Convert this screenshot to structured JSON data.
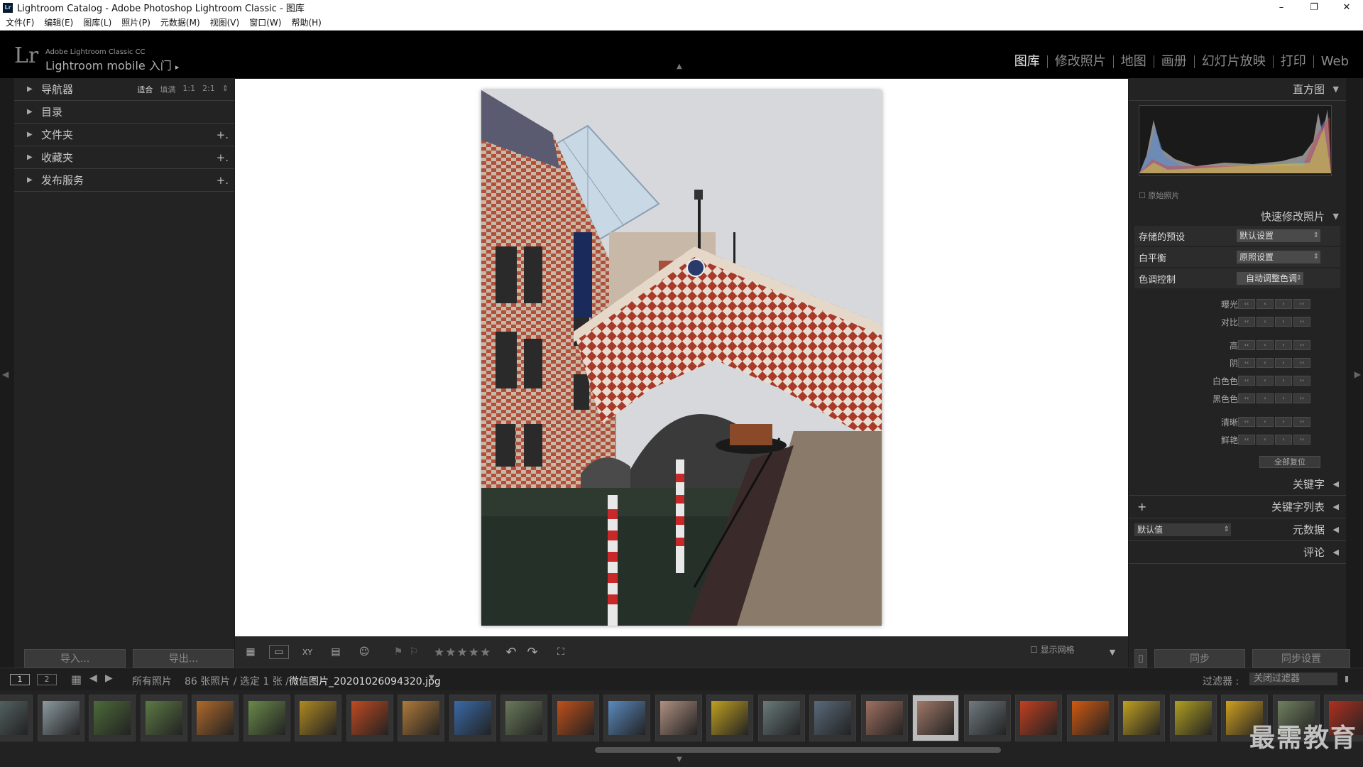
{
  "window": {
    "title": "Lightroom Catalog - Adobe Photoshop Lightroom Classic - 图库",
    "minimize": "–",
    "maximize": "❐",
    "close": "✕"
  },
  "menu": [
    "文件(F)",
    "编辑(E)",
    "图库(L)",
    "照片(P)",
    "元数据(M)",
    "视图(V)",
    "窗口(W)",
    "帮助(H)"
  ],
  "identity": {
    "logo": "Lr",
    "line1": "Adobe Lightroom Classic CC",
    "line2": "Lightroom mobile 入门",
    "arrow": "▸"
  },
  "modules": [
    "图库",
    "修改照片",
    "地图",
    "画册",
    "幻灯片放映",
    "打印",
    "Web"
  ],
  "left_panel": {
    "navigator": {
      "label": "导航器",
      "options": [
        "适合",
        "填满",
        "1:1",
        "2:1"
      ]
    },
    "items": [
      {
        "label": "目录",
        "plus": ""
      },
      {
        "label": "文件夹",
        "plus": "+."
      },
      {
        "label": "收藏夹",
        "plus": "+."
      },
      {
        "label": "发布服务",
        "plus": "+."
      }
    ],
    "import_label": "导入...",
    "export_label": "导出..."
  },
  "toolbar": {
    "stars": "★★★★★",
    "show_grid": "显示网格"
  },
  "right_panel": {
    "histogram": "直方图",
    "original_photo": "原始照片",
    "quick_develop": "快速修改照片",
    "saved_preset": {
      "label": "存储的预设",
      "value": "默认设置"
    },
    "white_balance": {
      "label": "白平衡",
      "value": "原照设置"
    },
    "tone_control": {
      "label": "色调控制",
      "button": "自动调整色调"
    },
    "sliders": [
      "曝光度",
      "对比度",
      "高光",
      "阴影",
      "白色色阶",
      "黑色色阶",
      "清晰度",
      "鲜艳度"
    ],
    "reset_all": "全部复位",
    "keywording": "关键字",
    "keyword_list": "关键字列表",
    "metadata": {
      "label": "元数据",
      "preset": "默认值"
    },
    "comments": "评论",
    "sync": "同步",
    "sync_settings": "同步设置"
  },
  "filmstrip_bar": {
    "page1": "1",
    "page2": "2",
    "source": "所有照片",
    "info": "86 张照片 / 选定 1 张 /",
    "filename": "微信图片_20201026094320.jpg",
    "filter_label": "过滤器 :",
    "filter_value": "关闭过滤器"
  },
  "thumbnail_colors": [
    "#5a6a6a",
    "#8c9aa0",
    "#4d6b3a",
    "#5d7a45",
    "#b06a2a",
    "#6a8a4a",
    "#b08a20",
    "#c04a20",
    "#b07a3a",
    "#3a6aa8",
    "#6a7a5a",
    "#c0501a",
    "#5a8ac0",
    "#b09080",
    "#c0a020",
    "#6a7a7a",
    "#5a6a7a",
    "#a07060",
    "#a07868",
    "#707a80",
    "#c04020",
    "#d05a10",
    "#c0a020",
    "#b0a020",
    "#d0a020",
    "#708060",
    "#b03020"
  ],
  "watermark": "最需教育",
  "colors": {
    "accent": "#e8e8e8",
    "panel": "#232323",
    "background": "#1b1b1b"
  }
}
